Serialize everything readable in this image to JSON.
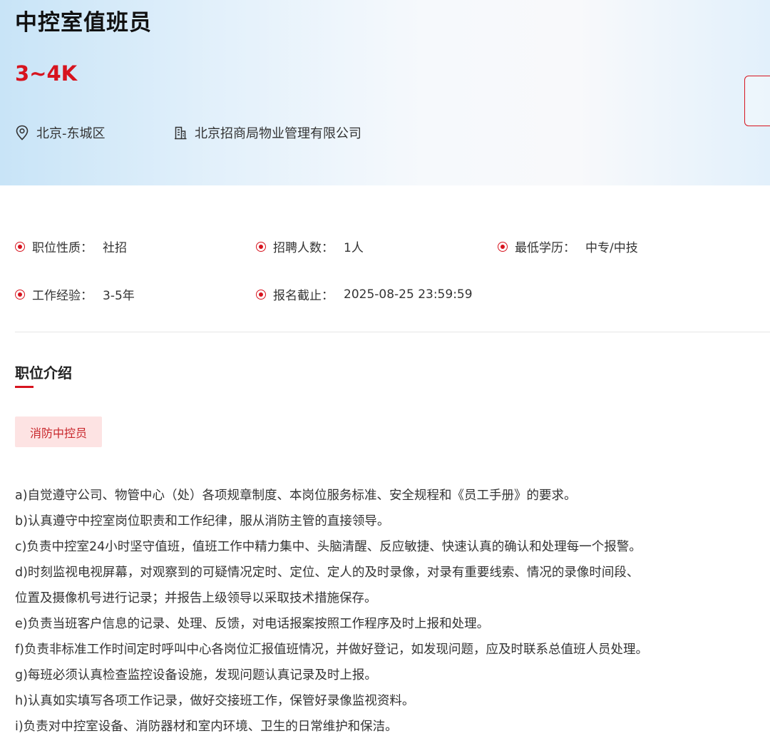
{
  "job": {
    "title": "中控室值班员",
    "salary": "3~4K",
    "location": "北京-东城区",
    "company": "北京招商局物业管理有限公司"
  },
  "info": {
    "nature_label": "职位性质：",
    "nature_value": "社招",
    "headcount_label": "招聘人数：",
    "headcount_value": "1人",
    "education_label": "最低学历：",
    "education_value": "中专/中技",
    "experience_label": "工作经验：",
    "experience_value": "3-5年",
    "deadline_label": "报名截止：",
    "deadline_value": "2025-08-25 23:59:59"
  },
  "section": {
    "title": "职位介绍",
    "tag": "消防中控员"
  },
  "description": [
    "a)自觉遵守公司、物管中心（处）各项规章制度、本岗位服务标准、安全规程和《员工手册》的要求。",
    "b)认真遵守中控室岗位职责和工作纪律，服从消防主管的直接领导。",
    "c)负责中控室24小时坚守值班，值班工作中精力集中、头脑清醒、反应敏捷、快速认真的确认和处理每一个报警。",
    "d)时刻监视电视屏幕，对观察到的可疑情况定时、定位、定人的及时录像，对录有重要线索、情况的录像时间段、",
    "位置及摄像机号进行记录；并报告上级领导以采取技术措施保存。",
    "e)负责当班客户信息的记录、处理、反馈，对电话报案按照工作程序及时上报和处理。",
    "f)负责非标准工作时间定时呼叫中心各岗位汇报值班情况，并做好登记，如发现问题，应及时联系总值班人员处理。",
    "g)每班必须认真检查监控设备设施，发现问题认真记录及时上报。",
    "h)认真如实填写各项工作记录，做好交接班工作，保管好录像监视资料。",
    "i)负责对中控室设备、消防器材和室内环境、卫生的日常维护和保洁。"
  ],
  "icons": {
    "location": "location-pin-icon",
    "company": "building-icon",
    "bullet": "radio-dot-icon"
  },
  "colors": {
    "accent": "#d7141f",
    "tag_bg": "#fde3e3"
  }
}
